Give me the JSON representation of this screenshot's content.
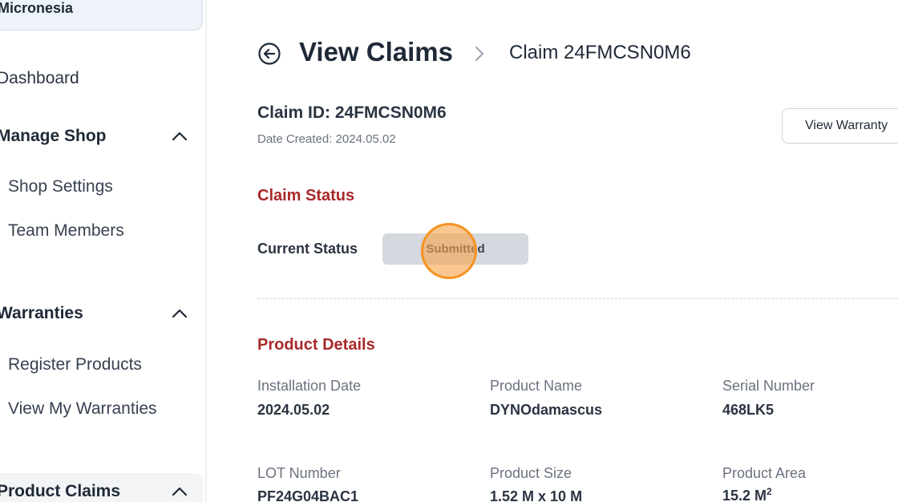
{
  "sidebar": {
    "org_name": "Micronesia",
    "dashboard": "Dashboard",
    "manage_shop": {
      "label": "Manage Shop",
      "items": [
        "Shop Settings",
        "Team Members"
      ]
    },
    "warranties": {
      "label": "Warranties",
      "items": [
        "Register Products",
        "View My Warranties"
      ]
    },
    "product_claims": {
      "label": "Product Claims"
    }
  },
  "header": {
    "title": "View Claims",
    "breadcrumb_current": "Claim 24FMCSN0M6"
  },
  "claim": {
    "id_text": "Claim ID: 24FMCSN0M6",
    "date_created": "Date Created: 2024.05.02",
    "view_warranty_label": "View Warranty"
  },
  "status_section": {
    "title": "Claim Status",
    "current_label": "Current Status",
    "current_value": "Submitted"
  },
  "product_details": {
    "title": "Product Details",
    "fields": [
      {
        "label": "Installation Date",
        "value": "2024.05.02"
      },
      {
        "label": "Product Name",
        "value": "DYNOdamascus"
      },
      {
        "label": "Serial Number",
        "value": "468LK5"
      },
      {
        "label": "LOT Number",
        "value": "PF24G04BAC1"
      },
      {
        "label": "Product Size",
        "value": "1.52 M x 10 M"
      },
      {
        "label": "Product Area",
        "value": "15.2 M",
        "value_sup": "2"
      }
    ]
  },
  "colors": {
    "accent_red": "#a8292a",
    "status_pill": "#d5d9df",
    "click_marker": "#f59320"
  },
  "icons": {
    "back": "arrow-left-circle-icon",
    "breadcrumb_separator": "chevron-right-icon",
    "collapse": "chevron-up-icon"
  }
}
